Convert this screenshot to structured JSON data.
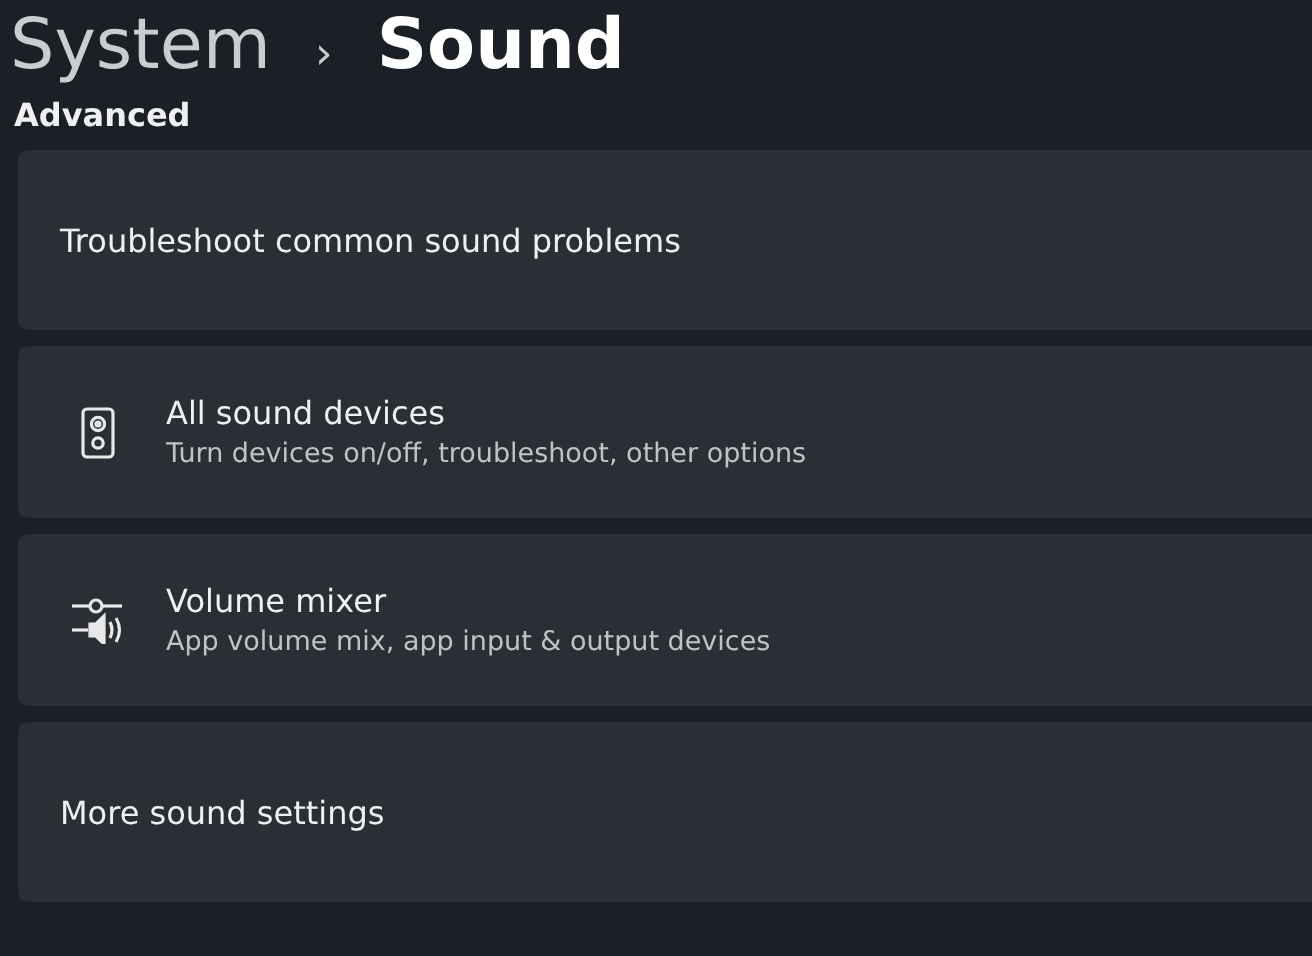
{
  "breadcrumb": {
    "parent": "System",
    "separator": "›",
    "current": "Sound"
  },
  "section": {
    "title": "Advanced",
    "items": [
      {
        "kind": "plain",
        "title": "Troubleshoot common sound problems"
      },
      {
        "kind": "speaker",
        "title": "All sound devices",
        "subtitle": "Turn devices on/off, troubleshoot, other options"
      },
      {
        "kind": "mixer",
        "title": "Volume mixer",
        "subtitle": "App volume mix, app input & output devices"
      },
      {
        "kind": "plain",
        "title": "More sound settings"
      }
    ]
  }
}
